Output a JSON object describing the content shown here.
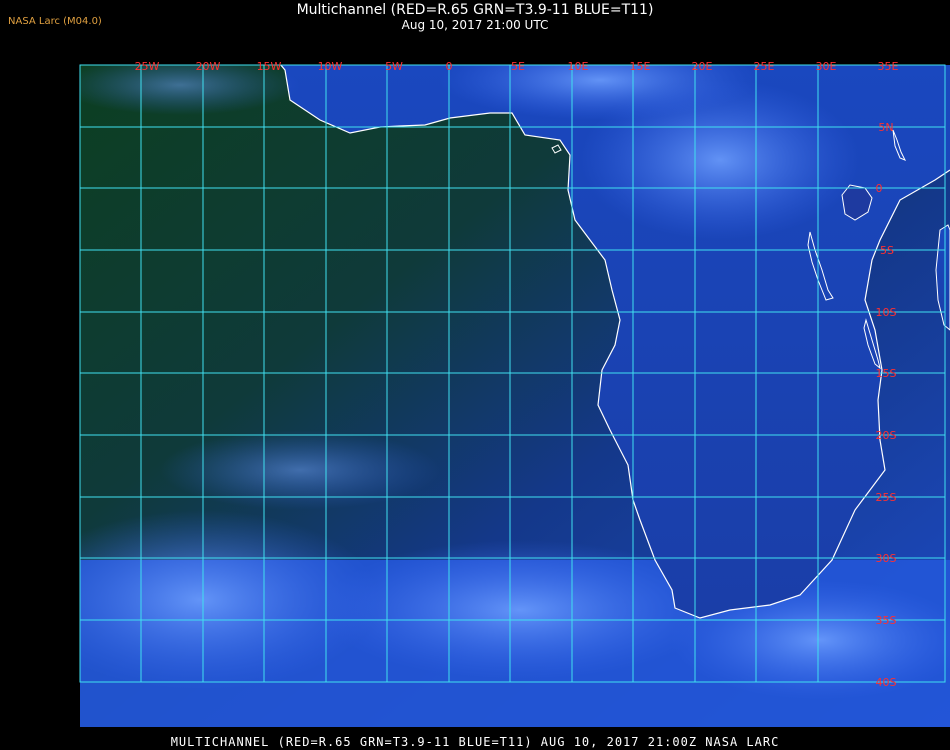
{
  "header": {
    "org_label": "NASA Larc (M04.0)",
    "title": "Multichannel (RED=R.65 GRN=T3.9-11 BLUE=T11)",
    "subtitle": "Aug 10, 2017 21:00 UTC"
  },
  "footer": {
    "caption": "MULTICHANNEL (RED=R.65 GRN=T3.9-11 BLUE=T11) AUG 10, 2017 21:00Z NASA LARC"
  },
  "map": {
    "grid_color": "#40e0f0",
    "coast_color": "#ffffff",
    "label_color": "#ff3030",
    "ocean_colors": [
      "#0a3a18",
      "#123a5a",
      "#1a45b8",
      "#2a60e0"
    ],
    "longitude_labels": [
      "25W",
      "20W",
      "15W",
      "10W",
      "5W",
      "0",
      "5E",
      "10E",
      "15E",
      "20E",
      "25E",
      "30E",
      "35E"
    ],
    "latitude_labels": [
      "5N",
      "0",
      "5S",
      "10S",
      "15S",
      "20S",
      "25S",
      "30S",
      "35S",
      "40S"
    ]
  }
}
